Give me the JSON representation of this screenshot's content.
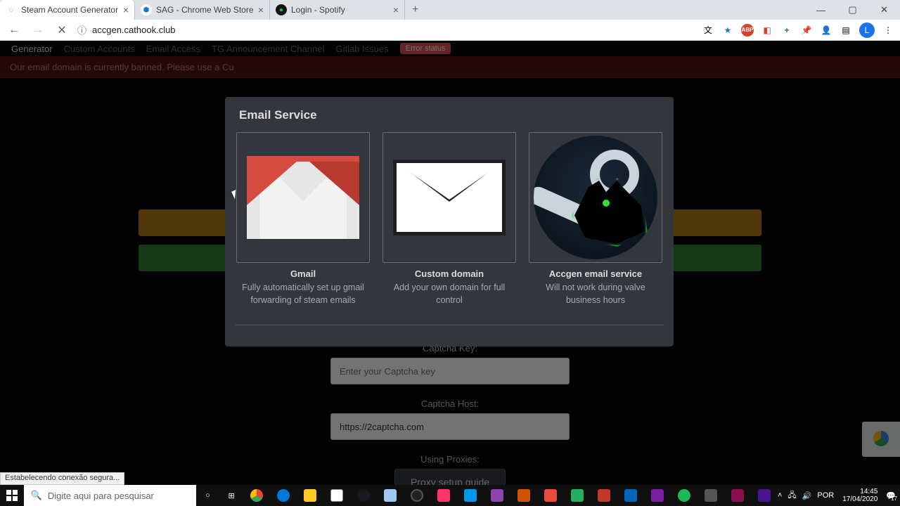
{
  "window": {
    "tabs": [
      {
        "title": "Steam Account Generator"
      },
      {
        "title": "SAG - Chrome Web Store"
      },
      {
        "title": "Login - Spotify"
      }
    ],
    "controls": {
      "min": "—",
      "max": "▢",
      "close": "✕"
    }
  },
  "addr": {
    "url": "accgen.cathook.club",
    "secure_icon": "ⓘ"
  },
  "ext_icons": [
    "⇅",
    "★",
    "ABP",
    "◧",
    "⬇",
    "📌",
    "👤",
    "⋯",
    "≡"
  ],
  "avatar_letter": "L",
  "page": {
    "nav": [
      "Generator",
      "Custom Accounts",
      "Email Access",
      "TG Announcement Channel",
      "Gitlab Issues"
    ],
    "nav_badge": "Error status",
    "banner": "Our email domain is currently banned. Please use a Cu",
    "captcha_key_label": "Captcha Key:",
    "captcha_key_placeholder": "Enter your Captcha key",
    "captcha_host_label": "Captcha Host:",
    "captcha_host_value": "https://2captcha.com",
    "proxies_label": "Using Proxies:",
    "proxy_button": "Proxy setup guide",
    "status_text": "Estabelecendo conexão segura..."
  },
  "modal": {
    "title": "Email Service",
    "options": [
      {
        "name": "Gmail",
        "desc": "Fully automatically set up gmail forwarding of steam emails"
      },
      {
        "name": "Custom domain",
        "desc": "Add your own domain for full control"
      },
      {
        "name": "Accgen email service",
        "desc": "Will not work during valve business hours"
      }
    ]
  },
  "taskbar": {
    "search_placeholder": "Digite aqui para pesquisar",
    "time": "14:45",
    "date": "17/04/2020",
    "lang": "POR",
    "notif": "17"
  }
}
